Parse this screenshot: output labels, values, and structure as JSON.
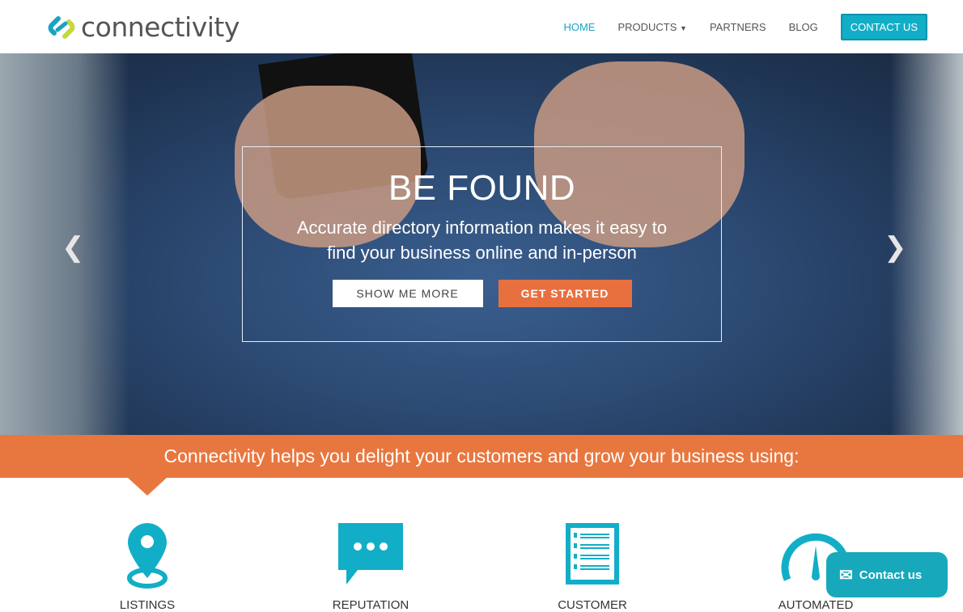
{
  "brand": {
    "name": "connectivity",
    "colors": {
      "teal": "#1ba3c2",
      "lime": "#c6d93a",
      "orange": "#e8773f"
    }
  },
  "nav": {
    "items": [
      {
        "label": "HOME",
        "active": true
      },
      {
        "label": "PRODUCTS"
      },
      {
        "label": "PARTNERS"
      },
      {
        "label": "BLOG"
      }
    ],
    "contact": "CONTACT US"
  },
  "hero": {
    "title": "BE FOUND",
    "subtitle_line1": "Accurate directory information makes it easy to",
    "subtitle_line2": "find your business online and in-person",
    "btn_more": "SHOW ME MORE",
    "btn_start": "GET STARTED"
  },
  "band": {
    "text": "Connectivity helps you delight your customers and grow your business using:"
  },
  "features": [
    {
      "label": "LISTINGS",
      "icon": "map-pin-icon"
    },
    {
      "label": "REPUTATION",
      "icon": "chat-bubble-icon"
    },
    {
      "label": "CUSTOMER",
      "icon": "customer-list-icon"
    },
    {
      "label": "AUTOMATED",
      "icon": "speedometer-icon"
    }
  ],
  "chat": {
    "label": "Contact us"
  }
}
